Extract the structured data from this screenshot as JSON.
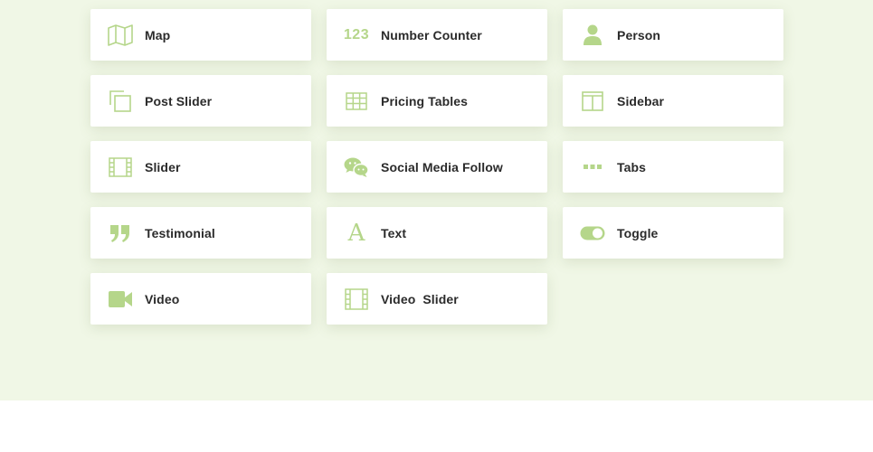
{
  "theme": {
    "section_bg": "#f0f7e6",
    "icon_color": "#b5d68a",
    "label_color": "#2b2b2b"
  },
  "modules": [
    {
      "label": "Map",
      "icon": "map-icon"
    },
    {
      "label": "Number Counter",
      "icon": "number-counter-icon",
      "icon_text": "123"
    },
    {
      "label": "Person",
      "icon": "person-icon"
    },
    {
      "label": "Post Slider",
      "icon": "post-slider-icon"
    },
    {
      "label": "Pricing Tables",
      "icon": "pricing-tables-icon"
    },
    {
      "label": "Sidebar",
      "icon": "sidebar-icon"
    },
    {
      "label": "Slider",
      "icon": "slider-icon"
    },
    {
      "label": "Social Media Follow",
      "icon": "social-media-follow-icon"
    },
    {
      "label": "Tabs",
      "icon": "tabs-icon"
    },
    {
      "label": "Testimonial",
      "icon": "testimonial-icon"
    },
    {
      "label": "Text",
      "icon": "text-icon",
      "icon_text": "A"
    },
    {
      "label": "Toggle",
      "icon": "toggle-icon"
    },
    {
      "label": "Video",
      "icon": "video-icon"
    },
    {
      "label": "Video  Slider",
      "icon": "video-slider-icon"
    }
  ]
}
